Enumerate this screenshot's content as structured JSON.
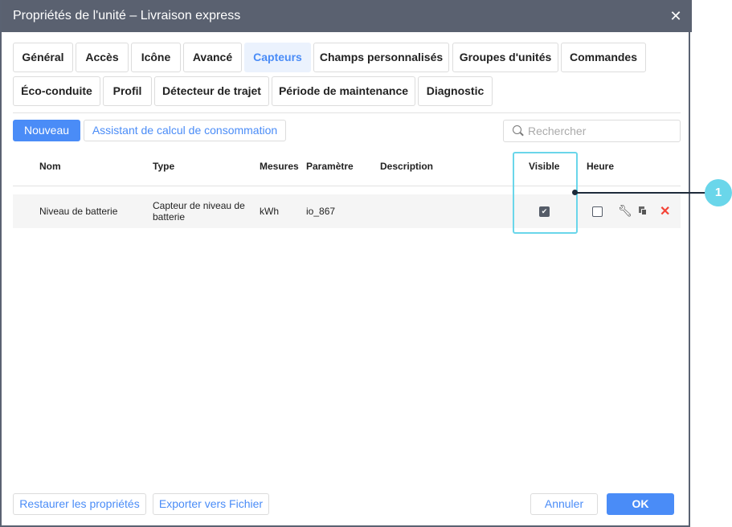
{
  "window": {
    "title": "Propriétés de l'unité – Livraison express",
    "close": "✕"
  },
  "tabs": [
    "Général",
    "Accès",
    "Icône",
    "Avancé",
    "Capteurs",
    "Champs personnalisés",
    "Groupes d'unités",
    "Commandes",
    "Éco-conduite",
    "Profil",
    "Détecteur de trajet",
    "Période de maintenance",
    "Diagnostic"
  ],
  "active_tab": "Capteurs",
  "toolbar": {
    "new_label": "Nouveau",
    "wizard_label": "Assistant de calcul de consommation",
    "search_placeholder": "Rechercher"
  },
  "table": {
    "headers": [
      "Nom",
      "Type",
      "Mesures",
      "Paramètre",
      "Description",
      "Visible",
      "Heure"
    ],
    "rows": [
      {
        "name": "Niveau de batterie",
        "type": "Capteur de niveau de batterie",
        "unit": "kWh",
        "param": "io_867",
        "description": "",
        "visible": true,
        "time": false
      }
    ]
  },
  "callout": "1",
  "footer": {
    "restore": "Restaurer les propriétés",
    "export": "Exporter vers Fichier",
    "cancel": "Annuler",
    "ok": "OK"
  },
  "colors": {
    "accent": "#4a8cf7",
    "highlight": "#6ad6ea",
    "header": "#5a6170",
    "delete": "#f44336"
  }
}
